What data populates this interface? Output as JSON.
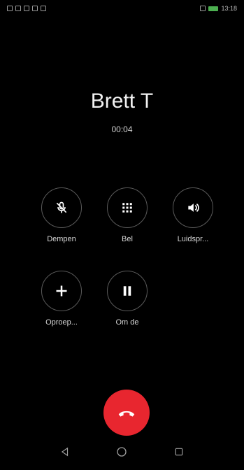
{
  "status_bar": {
    "time": "13:18"
  },
  "call": {
    "caller_name": "Brett T",
    "duration": "00:04"
  },
  "controls": {
    "mute_label": "Dempen",
    "keypad_label": "Bel",
    "speaker_label": "Luidspr...",
    "add_call_label": "Oproep...",
    "hold_label": "Om de"
  },
  "icons": {
    "mute": "mic-off-icon",
    "keypad": "dialpad-icon",
    "speaker": "speaker-icon",
    "add_call": "plus-icon",
    "hold": "pause-icon",
    "end_call": "hang-up-icon",
    "nav_back": "back-triangle-icon",
    "nav_home": "home-circle-icon",
    "nav_recents": "recents-square-icon"
  },
  "colors": {
    "background": "#000000",
    "end_call": "#e8262f",
    "button_border": "#5a5a5a"
  }
}
